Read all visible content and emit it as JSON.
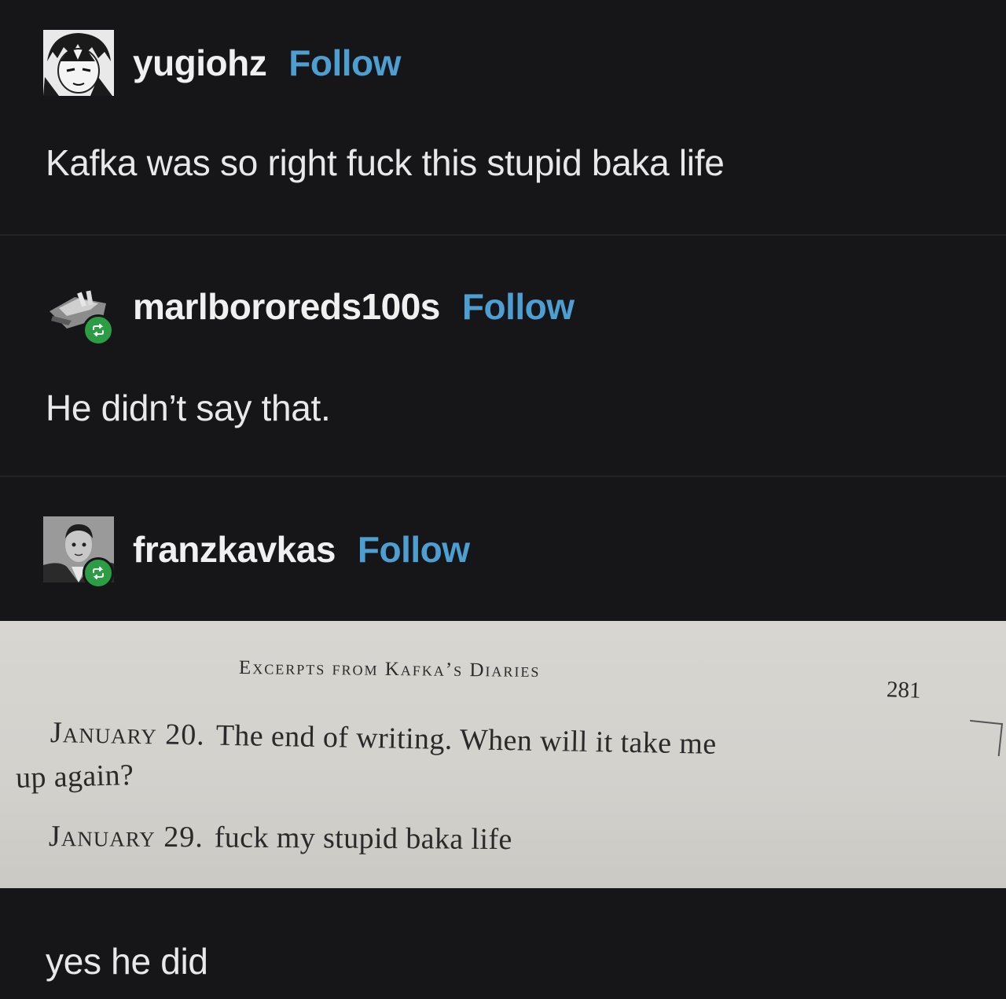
{
  "posts": [
    {
      "username": "yugiohz",
      "follow_label": "Follow",
      "text": "Kafka was so right fuck this stupid baka life",
      "avatar": "manga-character-avatar",
      "reblog": false
    },
    {
      "username": "marlbororeds100s",
      "follow_label": "Follow",
      "text": "He didn’t say that.",
      "avatar": "cigarette-pack-avatar",
      "reblog": true
    },
    {
      "username": "franzkavkas",
      "follow_label": "Follow",
      "text": "yes he did",
      "avatar": "kafka-portrait-avatar",
      "reblog": true
    }
  ],
  "book_page": {
    "running_head": "Excerpts from Kafka’s Diaries",
    "page_number": "281",
    "entry1_date": "January 20.",
    "entry1_text": "The end of writing. When will it take me",
    "entry1_continuation": "up again?",
    "entry2_date": "January 29.",
    "entry2_text": "fuck my stupid baka life"
  },
  "colors": {
    "background": "#161618",
    "follow_link": "#4d9ed1",
    "reblog_badge": "#2d9d45",
    "page_paper": "#d6d4cf"
  }
}
